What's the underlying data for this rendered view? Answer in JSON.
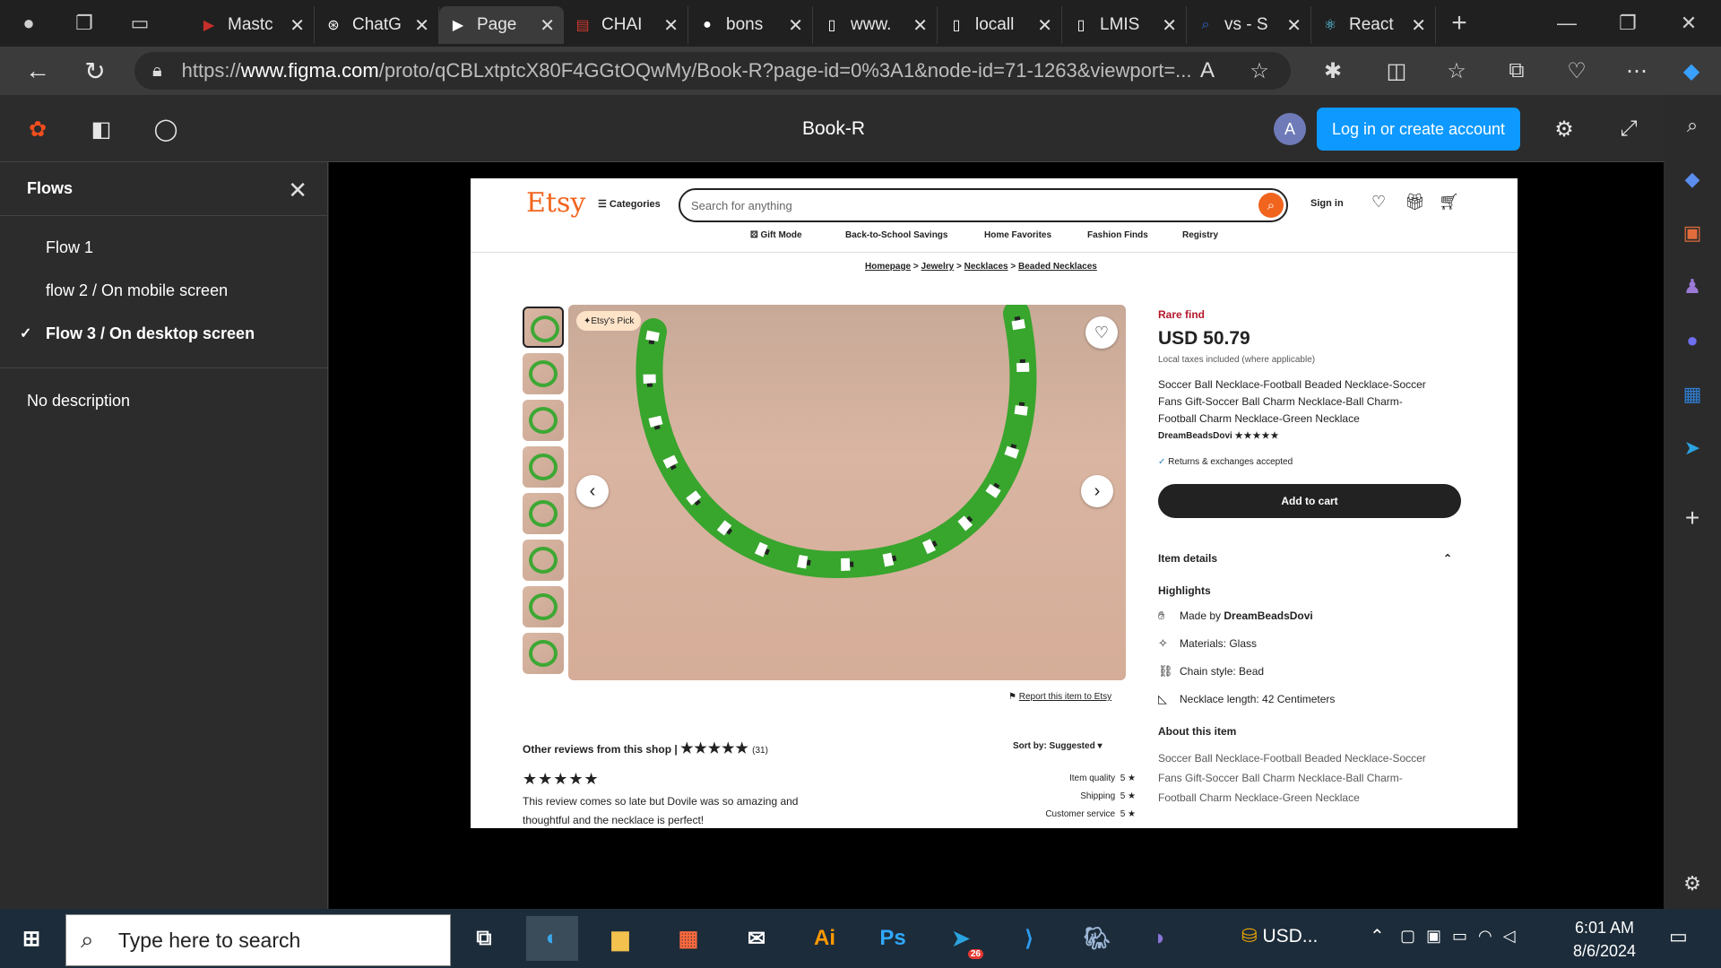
{
  "browser": {
    "tabs": [
      {
        "title": "Mastc",
        "icon": "youtube-icon",
        "color": "#c4302b"
      },
      {
        "title": "ChatG",
        "icon": "chatgpt-icon",
        "color": "#ffffff"
      },
      {
        "title": "Page",
        "icon": "play-icon",
        "color": "#ffffff",
        "active": true
      },
      {
        "title": "CHAI",
        "icon": "pdf-icon",
        "color": "#d03a2f"
      },
      {
        "title": "bons",
        "icon": "github-icon",
        "color": "#ffffff"
      },
      {
        "title": "www.",
        "icon": "file-icon",
        "color": "#ffffff"
      },
      {
        "title": "locall",
        "icon": "file-icon",
        "color": "#ffffff"
      },
      {
        "title": "LMIS",
        "icon": "file-icon",
        "color": "#ffffff"
      },
      {
        "title": "vs - S",
        "icon": "search-icon",
        "color": "#2f6bd6"
      },
      {
        "title": "React",
        "icon": "react-icon",
        "color": "#61dafb"
      }
    ],
    "url_prefix": "https://",
    "url_host": "www.figma.com",
    "url_path": "/proto/qCBLxtptcX80F4GGtOQwMy/Book-R?page-id=0%3A1&node-id=71-1263&viewport=..."
  },
  "figma": {
    "title": "Book-R",
    "avatar_letter": "A",
    "login_label": "Log in or create account",
    "flows_heading": "Flows",
    "flows": [
      {
        "label": "Flow 1",
        "selected": false
      },
      {
        "label": "flow 2 / On mobile screen",
        "selected": false
      },
      {
        "label": "Flow 3 / On desktop screen",
        "selected": true
      }
    ],
    "description": "No description"
  },
  "etsy": {
    "logo": "Etsy",
    "categories": "Categories",
    "search_placeholder": "Search for anything",
    "sign_in": "Sign in",
    "nav": [
      "Gift Mode",
      "Back-to-School Savings",
      "Home Favorites",
      "Fashion Finds",
      "Registry"
    ],
    "breadcrumb": [
      "Homepage",
      "Jewelry",
      "Necklaces",
      "Beaded Necklaces"
    ],
    "badge": "Etsy's Pick",
    "report": "Report this item to Etsy",
    "rare": "Rare find",
    "price": "USD 50.79",
    "tax": "Local taxes included (where applicable)",
    "title": "Soccer Ball Necklace-Football Beaded Necklace-Soccer Fans Gift-Soccer Ball Charm Necklace-Ball Charm-Football Charm Necklace-Green Necklace",
    "shop": "DreamBeadsDovi",
    "shop_stars": "★★★★★",
    "returns": "Returns & exchanges accepted",
    "add_to_cart": "Add to cart",
    "item_details": "Item details",
    "highlights_heading": "Highlights",
    "made_by_prefix": "Made by",
    "made_by": "DreamBeadsDovi",
    "materials": "Materials: Glass",
    "chain": "Chain style: Bead",
    "length": "Necklace length: 42 Centimeters",
    "about_heading": "About this item",
    "about_text": "Soccer Ball Necklace-Football Beaded Necklace-Soccer Fans Gift-Soccer Ball Charm Necklace-Ball Charm-Football Charm Necklace-Green Necklace",
    "reviews_heading": "Other reviews from this shop",
    "reviews_count": "(31)",
    "reviews_stars": "★★★★★",
    "sort": "Sort by: Suggested",
    "review_stars": "★★★★★",
    "review_text": "This review comes so late but Dovile was so amazing and thoughtful and the necklace is perfect!",
    "ratings": [
      {
        "label": "Item quality",
        "value": "5"
      },
      {
        "label": "Shipping",
        "value": "5"
      },
      {
        "label": "Customer service",
        "value": "5"
      }
    ]
  },
  "taskbar": {
    "search_placeholder": "Type here to search",
    "tray_text": "USD...",
    "time": "6:01 AM",
    "date": "8/6/2024",
    "telegram_badge": "26"
  }
}
